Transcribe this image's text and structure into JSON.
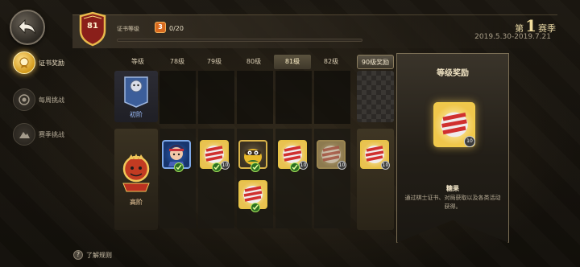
{
  "nav": {
    "items": [
      {
        "label": "证书奖励",
        "active": true,
        "icon": "certificate-icon"
      },
      {
        "label": "每周挑战",
        "active": false,
        "icon": "target-icon"
      },
      {
        "label": "赛季挑战",
        "active": false,
        "icon": "mountain-icon"
      }
    ]
  },
  "header": {
    "level": "81",
    "cert_label": "证书等级",
    "exp_badge": "3",
    "exp_value": "0/20",
    "exp_progress": 0,
    "season_prefix": "第",
    "season_number": "1",
    "season_suffix": "赛季",
    "season_dates": "2019.5.30-2019.7.21"
  },
  "columns": {
    "tier_header": "等级",
    "levels": [
      "78级",
      "79级",
      "80级",
      "81级",
      "82级"
    ],
    "current_level": "81级",
    "reward_header": "90级奖励"
  },
  "tiers": {
    "low": "初阶",
    "high": "高阶"
  },
  "panel": {
    "title": "等级奖励",
    "item_count": "10",
    "item_name": "糖果",
    "item_desc": "通过棋士证书、对局获取以及各类活动获得。"
  },
  "items": {
    "badge_counts": [
      "10",
      "10",
      "10",
      "10"
    ]
  },
  "footer": {
    "help_label": "了解规则"
  },
  "colors": {
    "gold": "#e7c247",
    "accent": "#f1dd9d",
    "background": "#15120d"
  }
}
